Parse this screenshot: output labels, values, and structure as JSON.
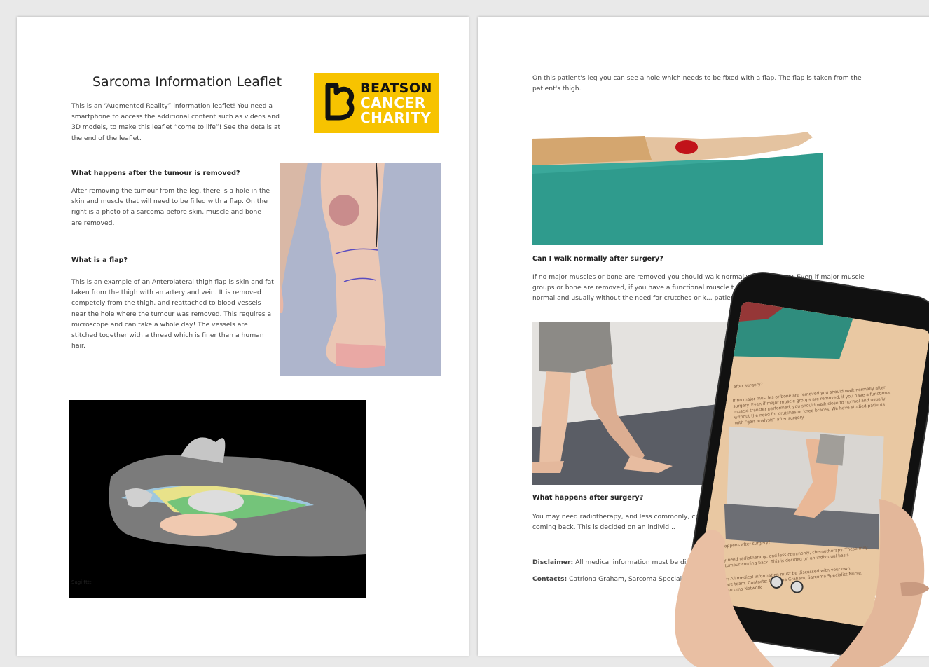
{
  "page1": {
    "title": "Sarcoma Information Leaflet",
    "intro": "This is an “Augmented Reality” information leaflet! You need a smartphone to access the additional content such as videos and 3D models, to make this leaflet “come to life”! See the details at the end of the leaflet.",
    "logo": {
      "line1": "BEATSON",
      "line2": "CANCER",
      "line3": "CHARITY",
      "color": "#f7c300"
    },
    "section1_heading": "What happens after the tumour is removed?",
    "section1_text": "After removing the tumour from the leg, there is a hole in the skin and muscle that will need to be filled with a flap. On the right is a photo of a sarcoma before skin, muscle and bone are removed.",
    "section2_heading": "What is a flap?",
    "section2_text": "This is an example of an Anterolateral thigh flap is skin and fat taken from the thigh with an artery and vein. It is removed competely from the thigh, and reattached to blood vessels near the hole where the tumour was removed. This requires a microscope and can take a whole day! The vessels are stitched together with a thread which is finer than a human hair.",
    "model_caption": "Sagi tttt"
  },
  "page2": {
    "intro": "On this patient's leg you can see a hole which needs to be fixed with a flap. The flap is taken from the patient's thigh.",
    "walk_heading": "Can I walk normally after surgery?",
    "walk_text": "If no major muscles or bone are removed you should walk normally after surgery. Even if major muscle groups or bone are removed, if you have a functional muscle t... ...formed, you should walk close to normal and usually without the need for crutches or k... patients with “gait analysis” after surgery.",
    "after_heading": "What happens after surgery?",
    "after_text": "You may need radiotherapy, and less commonly, chemot... tumour coming back. This is decided on an individ...",
    "disclaimer_label": "Disclaimer:",
    "disclaimer_text": "All medical information must be discus...",
    "contacts_label": "Contacts:",
    "contacts_text": "Catriona Graham, Sarcoma Specialist..."
  },
  "phone": {
    "screen_heading1": "after surgery?",
    "screen_text1": "If no major muscles or bone are removed you should walk normally after surgery. Even if major muscle groups are removed, if you have a functional muscle transfer performed, you should walk close to normal and usually without the need for crutches or knee braces. We have studied patients with “gait analysis” after surgery.",
    "screen_heading2": "What happens after surgery?",
    "screen_text2": "You may need radiotherapy, and less commonly, chemotherapy. These may reduce tumour coming back. This is decided on an individual basis.",
    "screen_text3": "Disclaimer: All medical information must be discussed with your own medical care team. Contacts: Catriona Graham, Sarcoma Specialist Nurse, Scottish Sarcoma Network"
  }
}
